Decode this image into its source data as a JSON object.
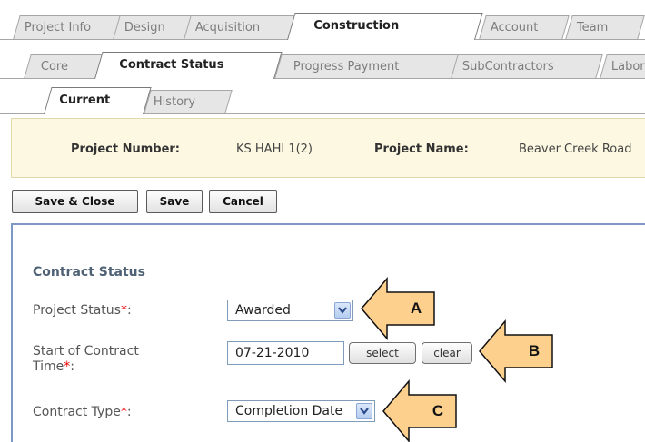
{
  "tabs_level1": [
    {
      "label": "Project Info",
      "active": false
    },
    {
      "label": "Design",
      "active": false
    },
    {
      "label": "Acquisition",
      "active": false
    },
    {
      "label": "Construction",
      "active": true
    },
    {
      "label": "Account",
      "active": false
    },
    {
      "label": "Team",
      "active": false
    }
  ],
  "tabs_level2": [
    {
      "label": "Core",
      "active": false
    },
    {
      "label": "Contract Status",
      "active": true
    },
    {
      "label": "Progress Payment",
      "active": false
    },
    {
      "label": "SubContractors",
      "active": false
    },
    {
      "label": "Labor",
      "active": false
    }
  ],
  "tabs_level3": [
    {
      "label": "Current",
      "active": true
    },
    {
      "label": "History",
      "active": false
    }
  ],
  "project": {
    "number_label": "Project Number:",
    "number_value": "KS HAHI 1(2)",
    "name_label": "Project Name:",
    "name_value": "Beaver Creek Road"
  },
  "toolbar": {
    "save_close_label": "Save & Close",
    "save_label": "Save",
    "cancel_label": "Cancel"
  },
  "form": {
    "section_title": "Contract Status",
    "project_status_label": "Project Status",
    "project_status_value": "Awarded",
    "start_time_label_line1": "Start of Contract",
    "start_time_label_line2": "Time",
    "start_time_value": "07-21-2010",
    "select_button_label": "select",
    "clear_button_label": "clear",
    "contract_type_label": "Contract Type",
    "contract_type_value": "Completion Date",
    "required_marker": "*",
    "colon": ":"
  },
  "callouts": {
    "a": "A",
    "b": "B",
    "c": "C"
  },
  "colors": {
    "callout_fill": "#fdd08e",
    "callout_stroke": "#111111",
    "info_bar_bg": "#fdf8e1",
    "panel_border": "#7d98c4",
    "required": "#ee0000"
  }
}
